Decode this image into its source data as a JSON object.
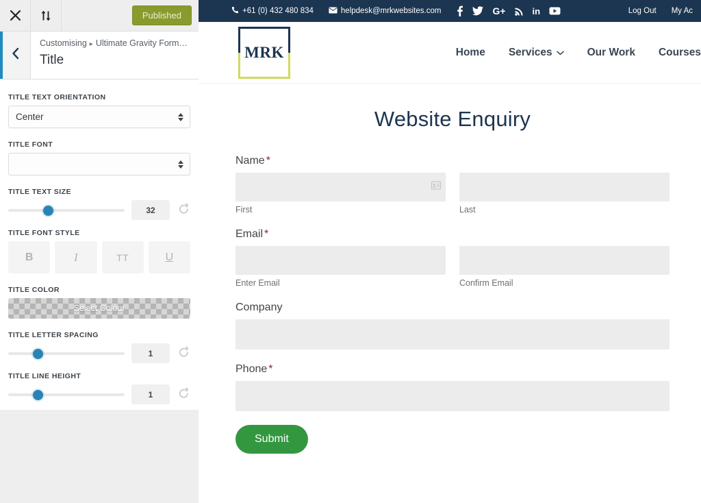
{
  "customizer": {
    "close_label": "close-icon",
    "reorder_label": "sort-arrows-icon",
    "publish_label": "Published",
    "back_label": "chevron-left-icon",
    "breadcrumb_prefix": "Customising",
    "breadcrumb_separator": "▸",
    "breadcrumb_current": "Ultimate Gravity Form…",
    "panel_title": "Title",
    "controls": {
      "orientation": {
        "label": "TITLE TEXT ORIENTATION",
        "value": "Center"
      },
      "font": {
        "label": "TITLE FONT",
        "value": ""
      },
      "text_size": {
        "label": "TITLE TEXT SIZE",
        "value": "32",
        "slider_percent": 34
      },
      "font_style": {
        "label": "TITLE FONT STYLE",
        "buttons": [
          {
            "name": "bold",
            "glyph": "B"
          },
          {
            "name": "italic",
            "glyph": "I"
          },
          {
            "name": "uppercase",
            "glyph": "TT"
          },
          {
            "name": "underline",
            "glyph": "U"
          }
        ]
      },
      "color": {
        "label": "TITLE COLOR",
        "button_label": "Select Colour"
      },
      "letter_spacing": {
        "label": "TITLE LETTER SPACING",
        "value": "1",
        "slider_percent": 25
      },
      "line_height": {
        "label": "TITLE LINE HEIGHT",
        "value": "1",
        "slider_percent": 25
      }
    }
  },
  "site": {
    "topbar": {
      "phone": "+61 (0) 432 480 834",
      "email": "helpdesk@mrkwebsites.com",
      "socials": [
        {
          "name": "facebook-icon",
          "glyph": "f"
        },
        {
          "name": "twitter-icon",
          "glyph": "twitter"
        },
        {
          "name": "googleplus-icon",
          "glyph": "G+"
        },
        {
          "name": "rss-icon",
          "glyph": "rss"
        },
        {
          "name": "linkedin-icon",
          "glyph": "in"
        },
        {
          "name": "youtube-icon",
          "glyph": "youtube"
        }
      ],
      "links": [
        {
          "name": "log-out",
          "label": "Log Out"
        },
        {
          "name": "my-account",
          "label": "My Ac"
        }
      ]
    },
    "logo_text": "MRK",
    "nav": [
      {
        "name": "home",
        "label": "Home",
        "dropdown": false
      },
      {
        "name": "services",
        "label": "Services",
        "dropdown": true
      },
      {
        "name": "our-work",
        "label": "Our Work",
        "dropdown": false
      },
      {
        "name": "courses",
        "label": "Courses",
        "dropdown": false
      }
    ],
    "page_title": "Website Enquiry",
    "form": {
      "name": {
        "label": "Name",
        "required": "*",
        "first_sub": "First",
        "last_sub": "Last",
        "first_value": "",
        "last_value": ""
      },
      "email": {
        "label": "Email",
        "required": "*",
        "enter_sub": "Enter Email",
        "confirm_sub": "Confirm Email",
        "enter_value": "",
        "confirm_value": ""
      },
      "company": {
        "label": "Company",
        "required": "",
        "value": ""
      },
      "phone": {
        "label": "Phone",
        "required": "*",
        "value": ""
      },
      "submit_label": "Submit"
    }
  },
  "colors": {
    "navy": "#1c3550",
    "logo_green": "#cfdb5a",
    "publish_olive": "#8a9b2e",
    "slider_blue": "#2884b5",
    "submit_green": "#339740",
    "accent_blue": "#1e8cbe"
  }
}
